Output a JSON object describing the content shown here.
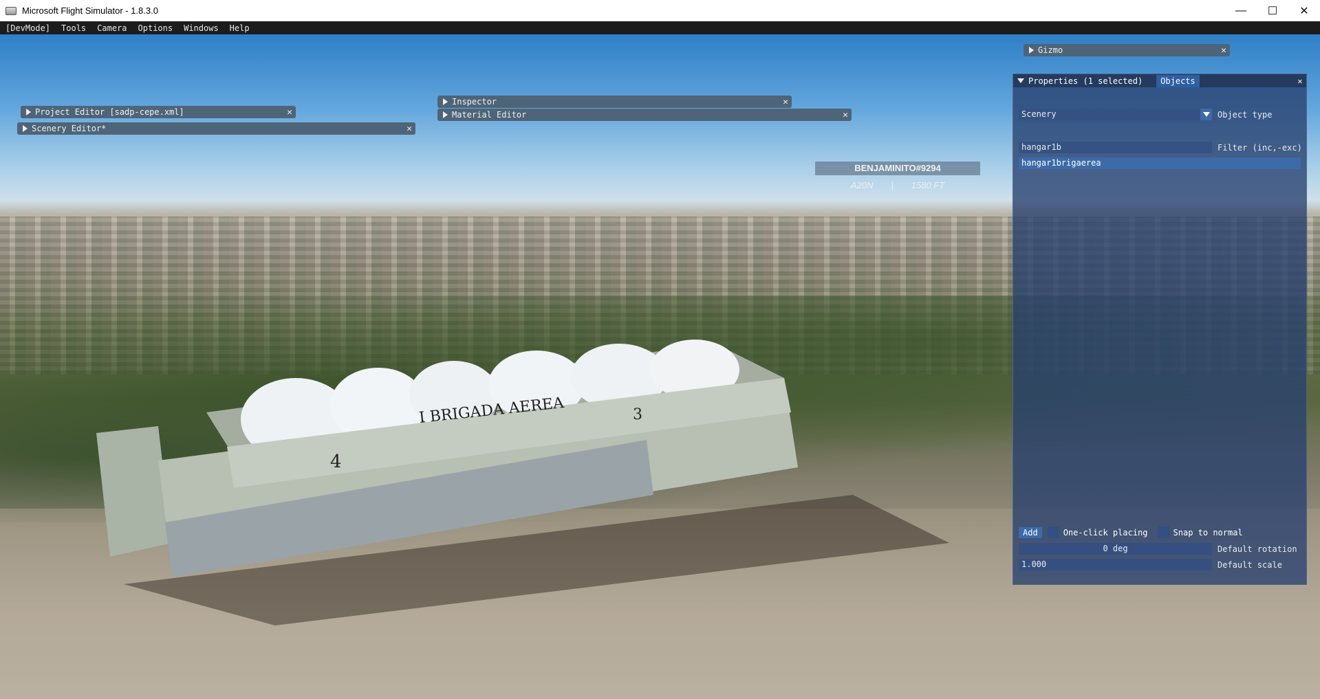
{
  "window": {
    "title": "Microsoft Flight Simulator - 1.8.3.0",
    "minimize": "—",
    "maximize": "☐",
    "close": "✕"
  },
  "menu": [
    "[DevMode]",
    "Tools",
    "Camera",
    "Options",
    "Windows",
    "Help"
  ],
  "panels": {
    "gizmo": "Gizmo",
    "project_editor": "Project Editor [sadp-cepe.xml]",
    "scenery_editor": "Scenery Editor*",
    "inspector": "Inspector",
    "material_editor": "Material Editor",
    "close_glyph": "✕"
  },
  "player": {
    "name": "BENJAMINITO#9294",
    "aircraft": "A20N",
    "separator": "|",
    "altitude": "1580 FT"
  },
  "hangar": {
    "sign": "I BRIGADA AEREA",
    "number_left": "4",
    "number_right": "3"
  },
  "properties": {
    "title": "Properties (1 selected)",
    "tab_objects": "Objects",
    "object_type_value": "Scenery",
    "object_type_label": "Object type",
    "filter_value": "hangar1b",
    "filter_label": "Filter (inc,-exc)",
    "results": [
      "hangar1brigaerea"
    ],
    "add_label": "Add",
    "one_click_label": "One-click placing",
    "snap_label": "Snap to normal",
    "rotation_value": "0 deg",
    "rotation_label": "Default rotation",
    "scale_value": "1.000",
    "scale_label": "Default scale"
  }
}
